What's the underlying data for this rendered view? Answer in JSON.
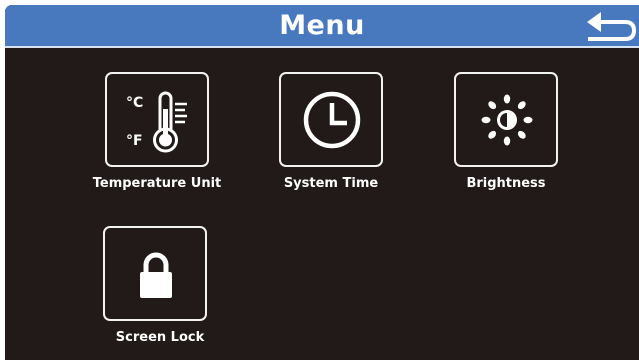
{
  "header": {
    "title": "Menu",
    "back_icon": "back-arrow-icon"
  },
  "menu_items": [
    {
      "label": "Temperature Unit",
      "icon": "thermometer-icon",
      "icon_text": {
        "celsius": "°C",
        "fahrenheit": "°F"
      }
    },
    {
      "label": "System Time",
      "icon": "clock-icon"
    },
    {
      "label": "Brightness",
      "icon": "brightness-icon"
    },
    {
      "label": "Screen Lock",
      "icon": "lock-icon"
    }
  ],
  "colors": {
    "header": "#4879bf",
    "background": "#211a18",
    "foreground": "#ffffff"
  }
}
